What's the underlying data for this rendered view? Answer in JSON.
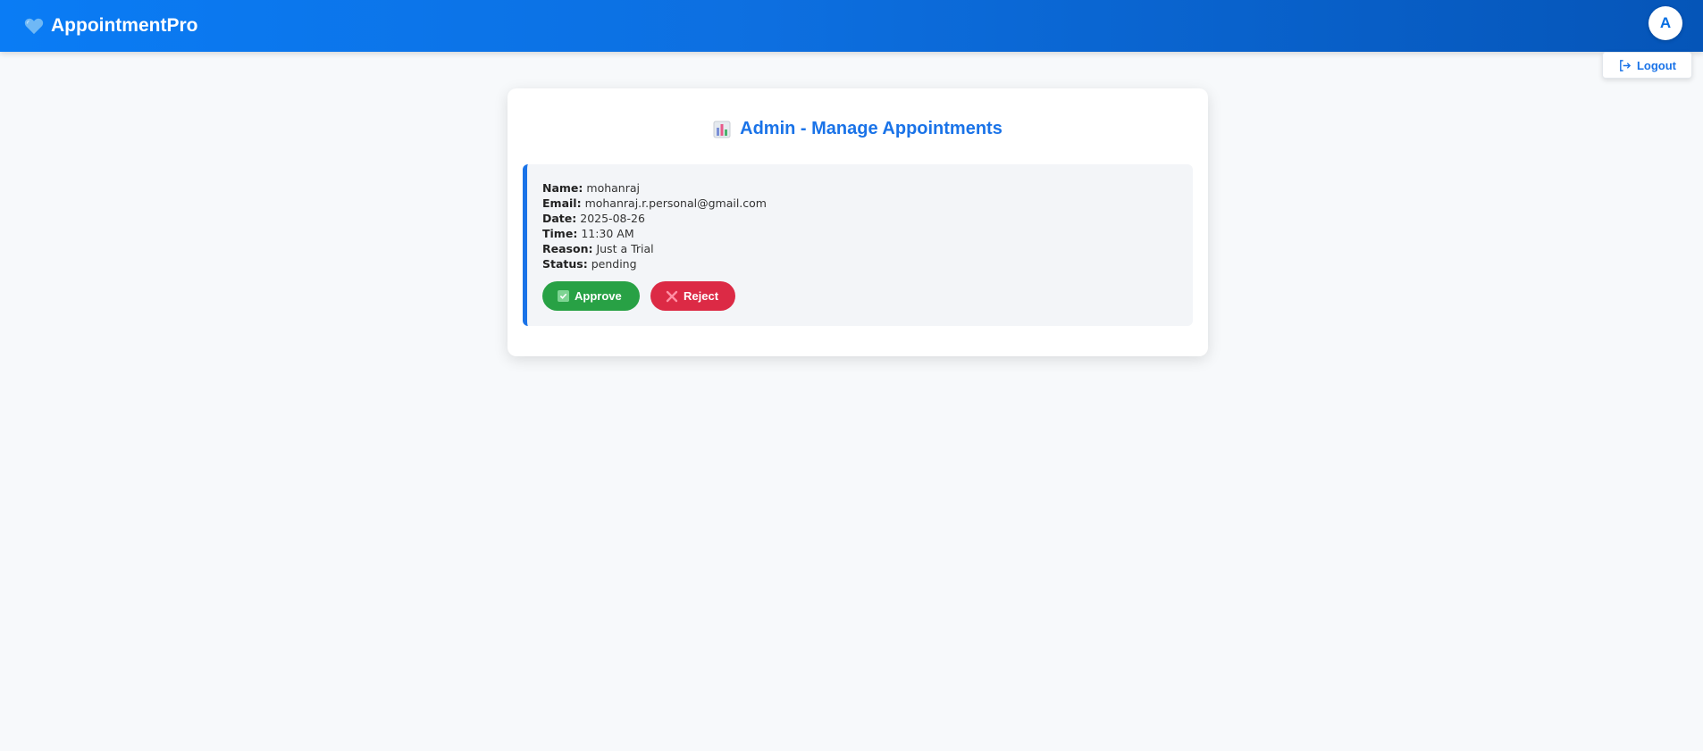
{
  "header": {
    "brand": "AppointmentPro",
    "brand_icon": "heart-icon",
    "avatar_initial": "A",
    "logout_label": "Logout",
    "colors": {
      "gradient_start": "#0a7cf5",
      "gradient_end": "#0555b8"
    }
  },
  "panel": {
    "title": "Admin - Manage Appointments",
    "title_icon": "bar-chart-icon",
    "accent": "#1a73e8"
  },
  "appointment": {
    "fields": [
      {
        "label": "Name:",
        "value": "mohanraj"
      },
      {
        "label": "Email:",
        "value": "mohanraj.r.personal@gmail.com"
      },
      {
        "label": "Date:",
        "value": "2025-08-26"
      },
      {
        "label": "Time:",
        "value": "11:30 AM"
      },
      {
        "label": "Reason:",
        "value": "Just a Trial"
      },
      {
        "label": "Status:",
        "value": "pending"
      }
    ],
    "approve_label": "Approve",
    "reject_label": "Reject",
    "colors": {
      "approve": "#28a145",
      "reject": "#dc2a45"
    }
  }
}
